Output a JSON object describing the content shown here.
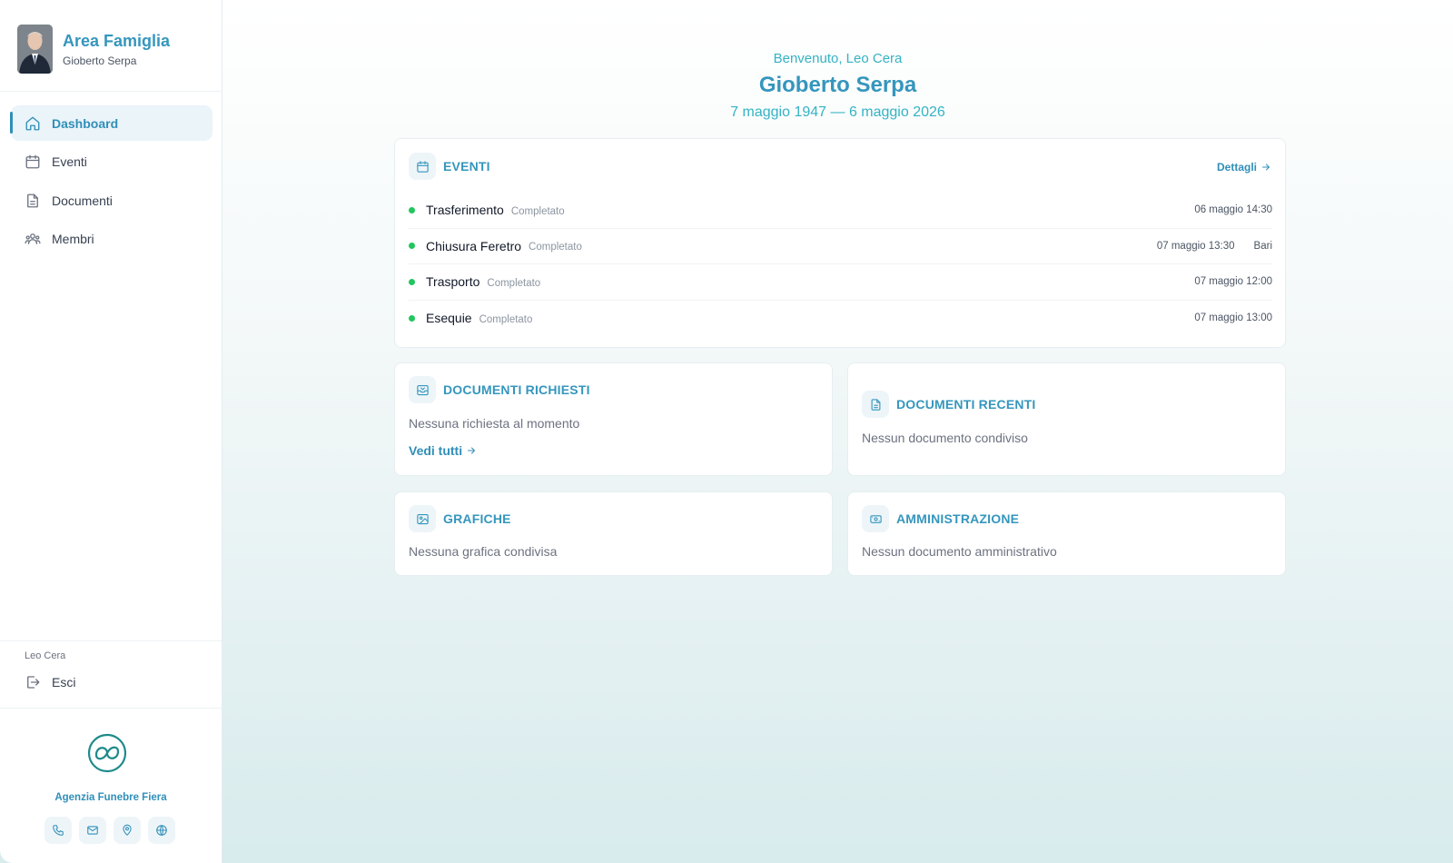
{
  "sidebar": {
    "title": "Area Famiglia",
    "subtitle": "Gioberto Serpa",
    "nav": [
      {
        "label": "Dashboard",
        "icon": "home-icon"
      },
      {
        "label": "Eventi",
        "icon": "calendar-icon"
      },
      {
        "label": "Documenti",
        "icon": "document-icon"
      },
      {
        "label": "Membri",
        "icon": "users-icon"
      }
    ],
    "user_name": "Leo Cera",
    "logout_label": "Esci",
    "agency_name": "Agenzia Funebre Fiera",
    "contacts": [
      "phone-icon",
      "mail-icon",
      "map-pin-icon",
      "globe-icon"
    ]
  },
  "header": {
    "welcome": "Benvenuto, Leo Cera",
    "deceased_name": "Gioberto Serpa",
    "dates": "7 maggio 1947 — 6 maggio 2026"
  },
  "events_card": {
    "title": "EVENTI",
    "details_label": "Dettagli",
    "items": [
      {
        "name": "Trasferimento",
        "status": "Completato",
        "datetime": "06 maggio 14:30",
        "location": ""
      },
      {
        "name": "Chiusura Feretro",
        "status": "Completato",
        "datetime": "07 maggio 13:30",
        "location": "Bari"
      },
      {
        "name": "Trasporto",
        "status": "Completato",
        "datetime": "07 maggio 12:00",
        "location": ""
      },
      {
        "name": "Esequie",
        "status": "Completato",
        "datetime": "07 maggio 13:00",
        "location": ""
      }
    ]
  },
  "requested_docs": {
    "title": "DOCUMENTI RICHIESTI",
    "empty": "Nessuna richiesta al momento",
    "link": "Vedi tutti"
  },
  "recent_docs": {
    "title": "DOCUMENTI RECENTI",
    "empty": "Nessun documento condiviso"
  },
  "graphics": {
    "title": "GRAFICHE",
    "empty": "Nessuna grafica condivisa"
  },
  "administration": {
    "title": "AMMINISTRAZIONE",
    "empty": "Nessun documento amministrativo"
  },
  "colors": {
    "accent": "#3596bd",
    "teal": "#34b3c4",
    "status_dot": "#22c55e"
  }
}
